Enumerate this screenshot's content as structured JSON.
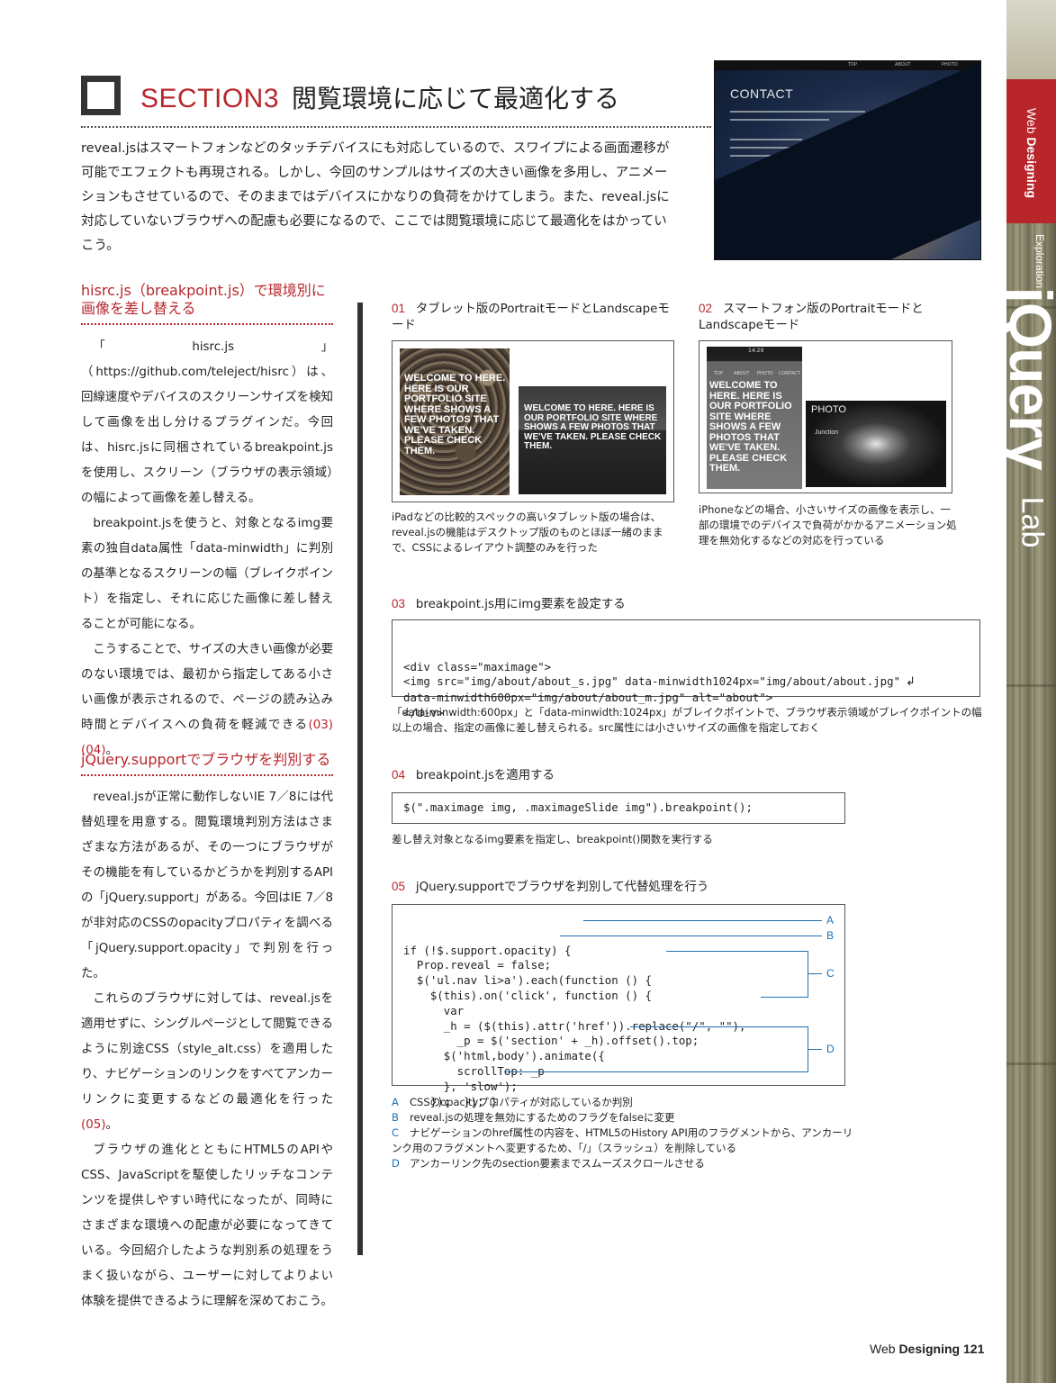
{
  "header": {
    "section_num": "SECTION3",
    "section_title": "閲覧環境に応じて最適化する"
  },
  "intro": "reveal.jsはスマートフォンなどのタッチデバイスにも対応しているので、スワイプによる画面遷移が可能でエフェクトも再現される。しかし、今回のサンプルはサイズの大きい画像を多用し、アニメーションもさせているので、そのままではデバイスにかなりの負荷をかけてしまう。また、reveal.jsに対応していないブラウザへの配慮も必要になるので、ここでは閲覧環境に応じて最適化をはかっていこう。",
  "hero": {
    "nav": [
      "TOP",
      "ABOUT",
      "PHOTO"
    ],
    "title": "CONTACT",
    "colors": {
      "accent": "#b8262b",
      "link_blue": "#1f6fb2"
    }
  },
  "side": {
    "tag_light": "Web",
    "tag_bold": "Designing",
    "tag_after": "Exploration",
    "jquery": "jQuery",
    "lab": "Lab"
  },
  "col1": {
    "heading1": "hisrc.js（breakpoint.js）で環境別に画像を差し替える",
    "p1": "「hisrc.js」（https://github.com/teleject/hisrc）は、回線速度やデバイスのスクリーンサイズを検知して画像を出し分けるプラグインだ。今回は、hisrc.jsに同梱されているbreakpoint.jsを使用し、スクリーン（ブラウザの表示領域）の幅によって画像を差し替える。",
    "p2": "breakpoint.jsを使うと、対象となるimg要素の独自data属性「data-minwidth」に判別の基準となるスクリーンの幅（ブレイクポイント）を指定し、それに応じた画像に差し替えることが可能になる。",
    "p3": "こうすることで、サイズの大きい画像が必要のない環境では、最初から指定してある小さい画像が表示されるので、ページの読み込み時間とデバイスへの負荷を軽減できる",
    "p3_ref": "(03) (04)",
    "p3_end": "。",
    "heading2": "jQuery.supportでブラウザを判別する",
    "p4": "reveal.jsが正常に動作しないIE 7／8には代替処理を用意する。閲覧環境判別方法はさまざまな方法があるが、その一つにブラウザがその機能を有しているかどうかを判別するAPIの「jQuery.support」がある。今回はIE 7／8が非対応のCSSのopacityプロパティを調べる「jQuery.support.opacity」で判別を行った。",
    "p5": "これらのブラウザに対しては、reveal.jsを適用せずに、シングルページとして閲覧できるように別途CSS（style_alt.css）を適用したり、ナビゲーションのリンクをすべてアンカーリンクに変更するなどの最適化を行った",
    "p5_ref": "(05)",
    "p5_end": "。",
    "p6": "ブラウザの進化とともにHTML5のAPIやCSS、JavaScriptを駆使したリッチなコンテンツを提供しやすい時代になったが、同時にさまざまな環境への配慮が必要になってきている。今回紹介したような判別系の処理をうまく扱いながら、ユーザーに対してよりよい体験を提供できるように理解を深めておこう。"
  },
  "fig01": {
    "num": "01",
    "label": "タブレット版のPortraitモードとLandscapeモード",
    "screen_text_portrait": "WELCOME TO HERE. HERE IS OUR PORTFOLIO SITE WHERE SHOWS A FEW PHOTOS THAT WE'VE TAKEN. PLEASE CHECK THEM.",
    "screen_text_landscape": "WELCOME TO HERE. HERE IS OUR PORTFOLIO SITE WHERE SHOWS A FEW PHOTOS THAT WE'VE TAKEN. PLEASE CHECK THEM.",
    "caption": "iPadなどの比較的スペックの高いタブレット版の場合は、reveal.jsの機能はデスクトップ版のものとほぼ一緒のままで、CSSによるレイアウト調整のみを行った"
  },
  "fig02": {
    "num": "02",
    "label": "スマートフォン版のPortraitモードとLandscapeモード",
    "phone_time": "14:29",
    "phone_nav": [
      "TOP",
      "ABOUT",
      "PHOTO",
      "CONTACT"
    ],
    "screen_text": "WELCOME TO HERE. HERE IS OUR PORTFOLIO SITE WHERE SHOWS A FEW PHOTOS THAT WE'VE TAKEN. PLEASE CHECK THEM.",
    "landscape_title": "PHOTO",
    "landscape_sub": "Junction",
    "caption": "iPhoneなどの場合、小さいサイズの画像を表示し、一部の環境でのデバイスで負荷がかかるアニメーション処理を無効化するなどの対応を行っている"
  },
  "fig03": {
    "num": "03",
    "label": "breakpoint.js用にimg要素を設定する",
    "code": [
      "<div class=\"maximage\">",
      "<img src=\"img/about/about_s.jpg\" data-minwidth1024px=\"img/about/about.jpg\"",
      "data-minwidth600px=\"img/about/about_m.jpg\" alt=\"about\">",
      "</div>"
    ],
    "caption": "「data-minwidth:600px」と「data-minwidth:1024px」がブレイクポイントで、ブラウザ表示領域がブレイクポイントの幅以上の場合、指定の画像に差し替えられる。src属性には小さいサイズの画像を指定しておく"
  },
  "fig04": {
    "num": "04",
    "label": "breakpoint.jsを適用する",
    "code": "$(\".maximage img, .maximageSlide img\").breakpoint();",
    "caption": "差し替え対象となるimg要素を指定し、breakpoint()関数を実行する"
  },
  "fig05": {
    "num": "05",
    "label": "jQuery.supportでブラウザを判別して代替処理を行う",
    "code": [
      "if (!$.support.opacity) {",
      "  Prop.reveal = false;",
      "  $('ul.nav li>a').each(function () {",
      "    $(this).on('click', function () {",
      "      var",
      "      _h = ($(this).attr('href')).replace(\"/\", \"\"),",
      "        _p = $('section' + _h).offset().top;",
      "      $('html,body').animate({",
      "        scrollTop: _p",
      "      }, 'slow');",
      "    });  }); }"
    ],
    "markers": [
      "A",
      "B",
      "C",
      "D"
    ]
  },
  "notes": [
    {
      "key": "A",
      "text": "CSSのopacityプロパティが対応しているか判別"
    },
    {
      "key": "B",
      "text": "reveal.jsの処理を無効にするためのフラグをfalseに変更"
    },
    {
      "key": "C",
      "text": "ナビゲーションのhref属性の内容を、HTML5のHistory API用のフラグメントから、アンカーリンク用のフラグメントへ変更するため、「/」（スラッシュ）を削除している"
    },
    {
      "key": "D",
      "text": "アンカーリンク先のsection要素までスムーズスクロールさせる"
    }
  ],
  "folio": {
    "light": "Web",
    "bold": "Designing",
    "page": "121"
  }
}
